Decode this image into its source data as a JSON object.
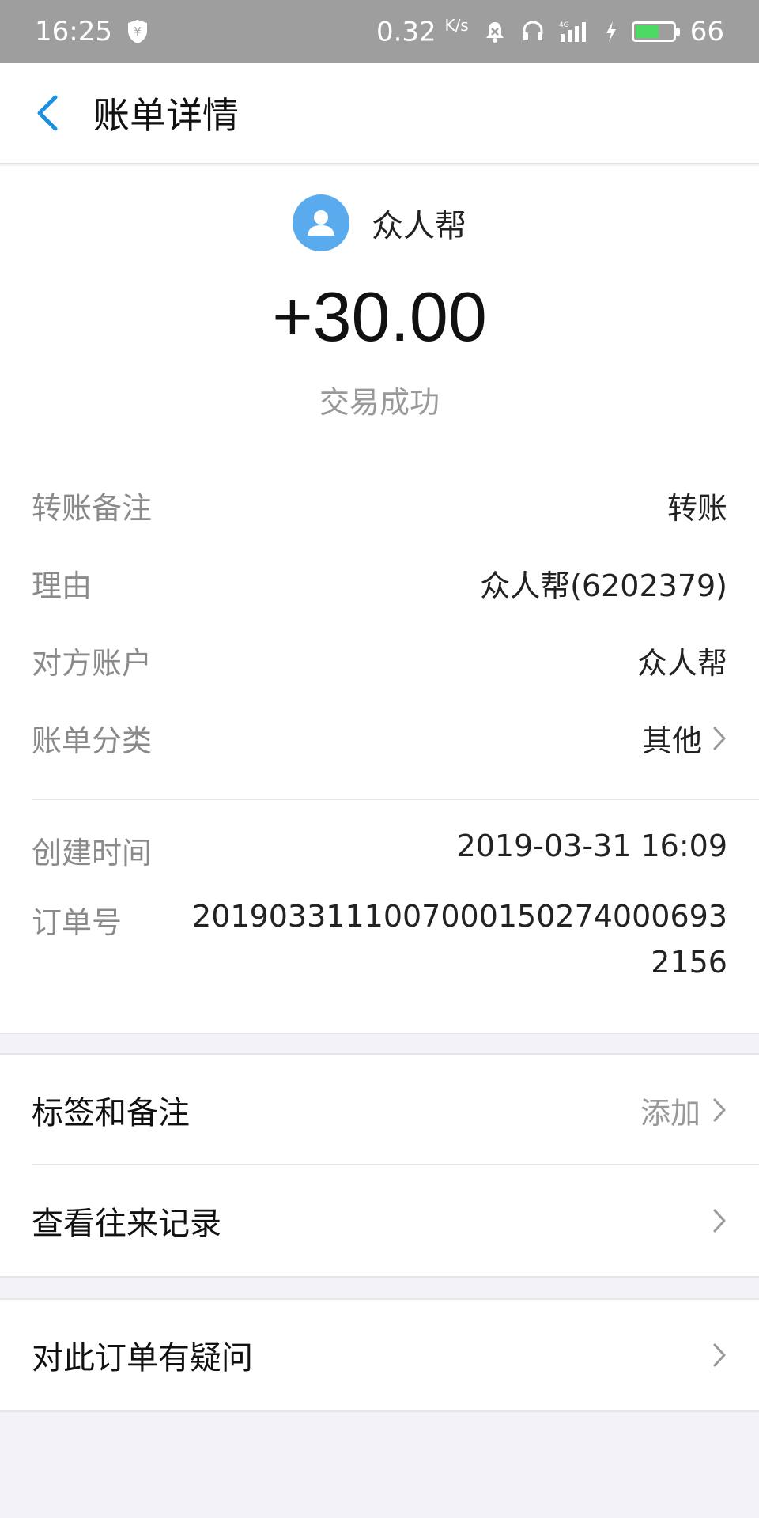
{
  "status_bar": {
    "time": "16:25",
    "speed": "0.32",
    "speed_unit": "K/s",
    "network": "4G",
    "battery": "66",
    "battery_fraction": 0.66
  },
  "nav": {
    "title": "账单详情"
  },
  "payee": {
    "name": "众人帮",
    "avatar_color": "#5aabee"
  },
  "amount": "+30.00",
  "transaction_status": "交易成功",
  "details": [
    {
      "key": "转账备注",
      "value": "转账"
    },
    {
      "key": "理由",
      "value": "众人帮(6202379)"
    },
    {
      "key": "对方账户",
      "value": "众人帮"
    },
    {
      "key": "账单分类",
      "value": "其他"
    }
  ],
  "created": {
    "key": "创建时间",
    "value": "2019-03-31 16:09"
  },
  "order": {
    "key": "订单号",
    "value": "2019033111007000150274000693215​6"
  },
  "actions": {
    "tags": {
      "label": "标签和备注",
      "hint": "添加"
    },
    "history": {
      "label": "查看往来记录"
    },
    "question": {
      "label": "对此订单有疑问"
    }
  },
  "colors": {
    "accent": "#1a8fe3",
    "background": "#f3f3f7"
  }
}
